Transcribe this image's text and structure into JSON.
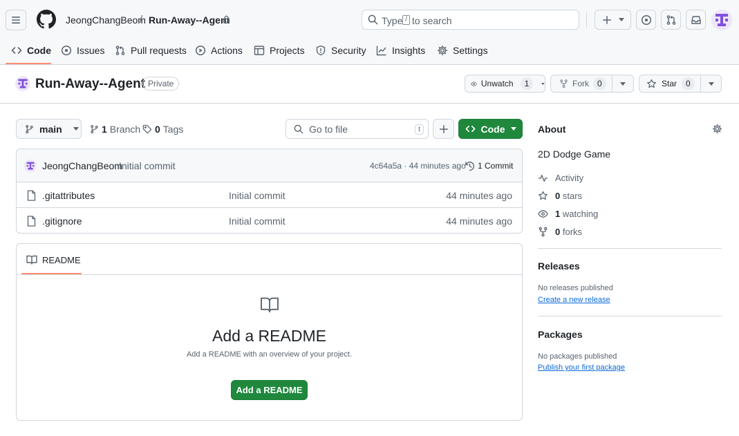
{
  "header": {
    "owner": "JeongChangBeom",
    "separator": "/",
    "repo": "Run-Away--Agent",
    "search_text_pre": "Type",
    "search_key": "/",
    "search_text_post": "to search"
  },
  "tabs": [
    {
      "label": "Code"
    },
    {
      "label": "Issues"
    },
    {
      "label": "Pull requests"
    },
    {
      "label": "Actions"
    },
    {
      "label": "Projects"
    },
    {
      "label": "Security"
    },
    {
      "label": "Insights"
    },
    {
      "label": "Settings"
    }
  ],
  "repo": {
    "name": "Run-Away--Agent",
    "visibility": "Private",
    "unwatch_label": "Unwatch",
    "watch_count": "1",
    "fork_label": "Fork",
    "fork_count": "0",
    "star_label": "Star",
    "star_count": "0"
  },
  "toolbar": {
    "branch": "main",
    "branch_count": "1",
    "branch_label": "Branch",
    "tag_count": "0",
    "tag_label": "Tags",
    "goto_placeholder": "Go to file",
    "goto_key": "t",
    "code_label": "Code"
  },
  "commit": {
    "author": "JeongChangBeom",
    "message": "Initial commit",
    "hash_time": "4c64a5a · 44 minutes ago",
    "count_label": "1 Commit"
  },
  "files": [
    {
      "name": ".gitattributes",
      "message": "Initial commit",
      "time": "44 minutes ago"
    },
    {
      "name": ".gitignore",
      "message": "Initial commit",
      "time": "44 minutes ago"
    }
  ],
  "readme": {
    "tab_label": "README",
    "title": "Add a README",
    "description": "Add a README with an overview of your project.",
    "button": "Add a README"
  },
  "about": {
    "heading": "About",
    "description": "2D Dodge Game",
    "activity": "Activity",
    "stars_count": "0",
    "stars_label": "stars",
    "watching_count": "1",
    "watching_label": "watching",
    "forks_count": "0",
    "forks_label": "forks"
  },
  "releases": {
    "heading": "Releases",
    "empty": "No releases published",
    "link": "Create a new release"
  },
  "packages": {
    "heading": "Packages",
    "empty": "No packages published",
    "link": "Publish your first package"
  },
  "colors": {
    "accent_green": "#1f883d",
    "link_blue": "#0969da",
    "tab_underline": "#fd8c73",
    "avatar_purple": "#8250df"
  }
}
